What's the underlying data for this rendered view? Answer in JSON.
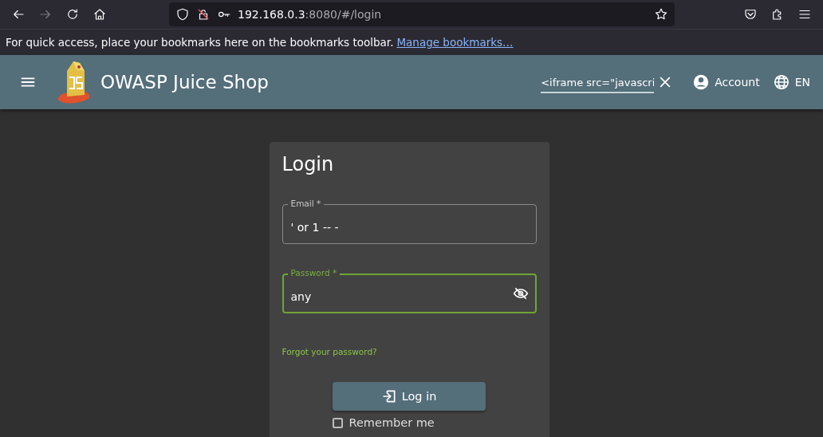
{
  "browser": {
    "url_host": "192.168.0.3",
    "url_path": ":8080/#/login",
    "bookmarks_hint": "For quick access, place your bookmarks here on the bookmarks toolbar.",
    "bookmarks_link": "Manage bookmarks…"
  },
  "app_bar": {
    "title": "OWASP Juice Shop",
    "search_value": "<iframe src=\"javascri",
    "account": "Account",
    "language": "EN"
  },
  "login": {
    "title": "Login",
    "fields": [
      {
        "label": "Email *",
        "value": "' or 1 -- -",
        "focused": false,
        "kind": "text"
      },
      {
        "label": "Password *",
        "value": "any",
        "focused": true,
        "kind": "password"
      }
    ],
    "forgot": "Forgot your password?",
    "login_button": "Log in",
    "remember": {
      "label": "Remember me",
      "checked": false
    }
  }
}
